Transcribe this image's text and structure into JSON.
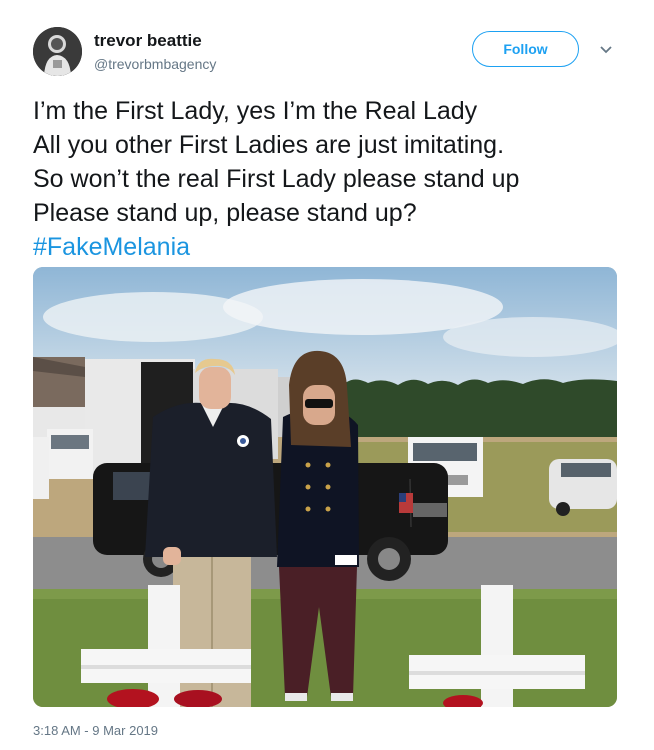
{
  "user": {
    "name": "trevor beattie",
    "handle": "@trevorbmbagency"
  },
  "follow_label": "Follow",
  "tweet": {
    "lines": [
      "I’m the First Lady, yes I’m the Real Lady",
      "All you other First Ladies are just imitating.",
      "So won’t the real First Lady please stand up",
      "Please stand up, please stand up?"
    ],
    "hashtag": "#FakeMelania"
  },
  "timestamp": "3:18 AM - 9 Mar 2019",
  "icons": {
    "menu": "chevron-down-icon",
    "avatar": "avatar-image"
  },
  "colors": {
    "accent": "#1da1f2",
    "hashtag": "#1b95e0",
    "secondary_text": "#657786"
  }
}
